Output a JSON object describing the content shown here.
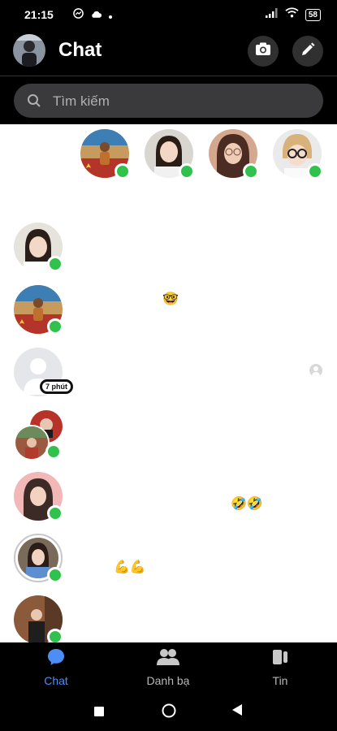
{
  "status_bar": {
    "time": "21:15",
    "battery": "58"
  },
  "header": {
    "title": "Chat"
  },
  "search": {
    "placeholder": "Tìm kiếm"
  },
  "colors": {
    "accent": "#4c8ef5",
    "online": "#31c24d",
    "content_bg": "#ffffff",
    "bar_bg": "#000000"
  },
  "stories": [
    {
      "name": "story-1",
      "online": true
    },
    {
      "name": "story-2",
      "online": true
    },
    {
      "name": "story-3",
      "online": true
    },
    {
      "name": "story-4",
      "online": true
    }
  ],
  "chats": [
    {
      "emoji": "",
      "online": true
    },
    {
      "emoji": "🤓",
      "online": true
    },
    {
      "emoji": "😂😂",
      "badge": "7 phút",
      "online": false
    },
    {
      "emoji": "",
      "online": true
    },
    {
      "emoji": "🤣🤣",
      "online": true
    },
    {
      "emoji": "💪💪",
      "online": true
    },
    {
      "emoji": "",
      "online": true
    }
  ],
  "nav": {
    "chat_label": "Chat",
    "contacts_label": "Danh bạ",
    "stories_label": "Tin"
  }
}
